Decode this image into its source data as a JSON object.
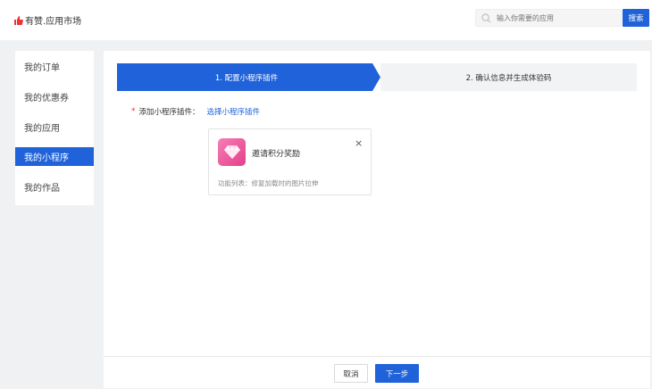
{
  "header": {
    "brand": "有赞.应用市场",
    "search_placeholder": "输入你需要的应用",
    "search_button": "搜索"
  },
  "sidebar": {
    "items": [
      {
        "label": "我的订单"
      },
      {
        "label": "我的优惠券"
      },
      {
        "label": "我的应用"
      },
      {
        "label": "我的小程序",
        "active": true
      },
      {
        "label": "我的作品"
      }
    ]
  },
  "steps": [
    {
      "label": "1. 配置小程序插件",
      "active": true
    },
    {
      "label": "2. 确认信息并生成体验码",
      "active": false
    }
  ],
  "form": {
    "required_mark": "*",
    "label": "添加小程序插件：",
    "link": "选择小程序插件"
  },
  "plugin_card": {
    "name": "邀请积分奖励",
    "close": "×",
    "features": "功能列表：修复加载时的图片拉伸",
    "icon": "diamond-icon"
  },
  "footer": {
    "cancel": "取消",
    "next": "下一步"
  },
  "colors": {
    "primary": "#1f62d9",
    "required": "#e33333",
    "icon_gradient": [
      "#f67eb5",
      "#e3408b"
    ]
  }
}
